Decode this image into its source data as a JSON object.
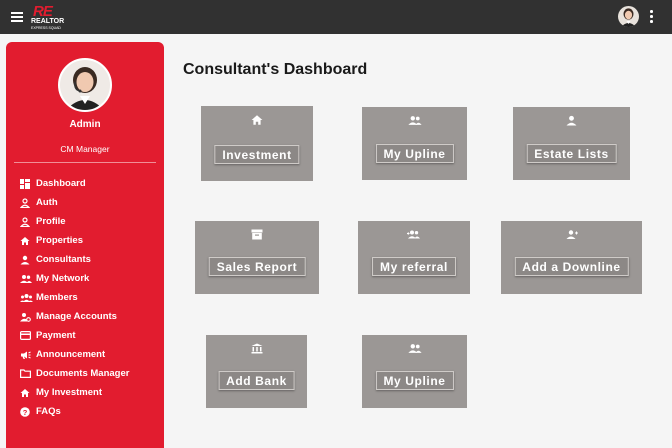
{
  "app": {
    "logo_mark": "RE",
    "logo_name": "REALTOR",
    "logo_tagline": "EXPRESS SQUAD"
  },
  "user": {
    "name": "Admin",
    "role": "CM Manager"
  },
  "sidebar": {
    "items": [
      {
        "label": "Dashboard",
        "icon": "dashboard-icon"
      },
      {
        "label": "Auth",
        "icon": "person-outline-icon"
      },
      {
        "label": "Profile",
        "icon": "person-outline-icon"
      },
      {
        "label": "Properties",
        "icon": "home-icon"
      },
      {
        "label": "Consultants",
        "icon": "person-icon"
      },
      {
        "label": "My Network",
        "icon": "group-icon"
      },
      {
        "label": "Members",
        "icon": "groups-icon"
      },
      {
        "label": "Manage Accounts",
        "icon": "manage-accounts-icon"
      },
      {
        "label": "Payment",
        "icon": "credit-card-icon"
      },
      {
        "label": "Announcement",
        "icon": "campaign-icon"
      },
      {
        "label": "Documents Manager",
        "icon": "folder-icon"
      },
      {
        "label": "My Investment",
        "icon": "home-icon"
      },
      {
        "label": "FAQs",
        "icon": "help-icon"
      }
    ]
  },
  "main": {
    "title": "Consultant's Dashboard",
    "cards": [
      {
        "label": "Investment",
        "icon": "home-icon"
      },
      {
        "label": "My Upline",
        "icon": "group-icon"
      },
      {
        "label": "Estate Lists",
        "icon": "person-icon"
      },
      {
        "label": "Sales Report",
        "icon": "inventory-icon"
      },
      {
        "label": "My referral",
        "icon": "group-add-icon"
      },
      {
        "label": "Add a Downline",
        "icon": "person-add-icon"
      },
      {
        "label": "Add Bank",
        "icon": "bank-icon"
      },
      {
        "label": "My Upline",
        "icon": "group-icon"
      }
    ]
  }
}
